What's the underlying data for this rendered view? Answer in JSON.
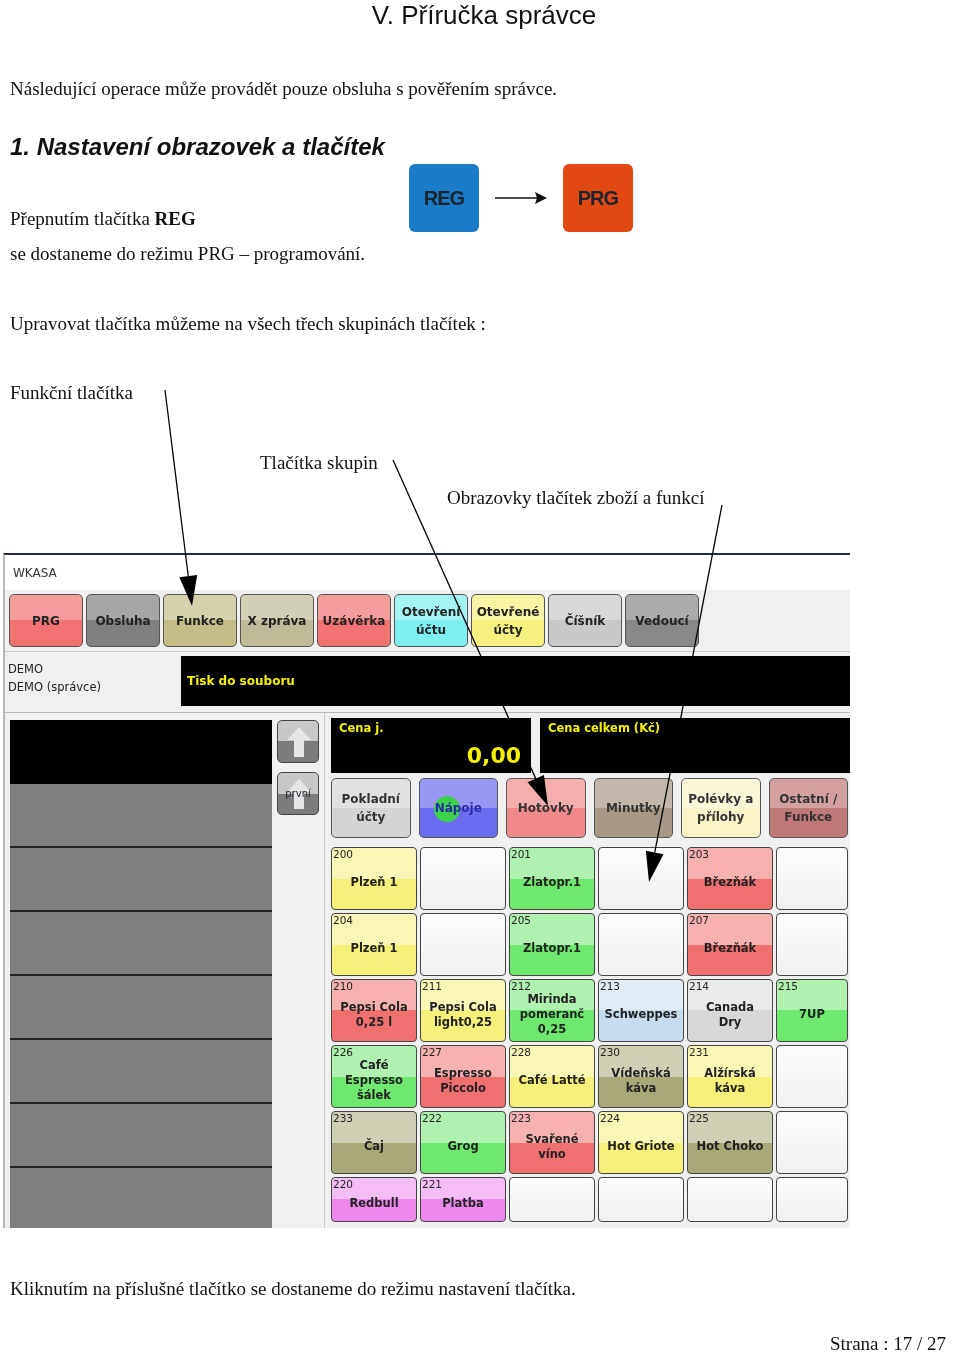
{
  "heading": "V. Příručka správce",
  "intro": "Následující operace může provádět pouze obsluha s pověřením správce.",
  "section": {
    "title": "1. Nastavení obrazovek a tlačítek",
    "lines": [
      "Přepnutím tlačítka **REG**",
      "se dostaneme do režimu PRG – programování."
    ],
    "modes": [
      {
        "label": "REG",
        "color": "#1a7cc6"
      },
      {
        "label": "PRG",
        "color": "#e04a12"
      }
    ]
  },
  "groups_intro": "Upravovat tlačítka můžeme na všech třech skupinách tlačítek :",
  "callouts": [
    "Funkční tlačítka",
    "Tlačítka skupin",
    "Obrazovky tlačítek zboží a funkcí"
  ],
  "app": {
    "title": "WKASA",
    "function_buttons": [
      {
        "label": "PRG",
        "color": "#f07272"
      },
      {
        "label": "Obsluha",
        "color": "#808080"
      },
      {
        "label": "Funkce",
        "color": "#c4be86"
      },
      {
        "label": "X zpráva",
        "color": "#bfbb98"
      },
      {
        "label": "Uzávěrka",
        "color": "#f07272"
      },
      {
        "label": "Otevření\núčtu",
        "color": "#7ef0f0"
      },
      {
        "label": "Otevřené\núčty",
        "color": "#f6f07e"
      },
      {
        "label": "Číšník",
        "color": "#c8c8c8"
      },
      {
        "label": "Vedoucí",
        "color": "#888888"
      }
    ],
    "user_lines": [
      "DEMO",
      "DEMO (správce)"
    ],
    "message": "Tisk do souboru",
    "nav": {
      "first_label": "první"
    },
    "unit_price": {
      "label": "Cena j.",
      "value": "0,00"
    },
    "total_price": {
      "label": "Cena celkem (Kč)"
    },
    "groups": [
      {
        "label": "Pokladní\núčty",
        "color": "#d4d4d4",
        "selected": false
      },
      {
        "label": "Nápoje",
        "color": "#6c6cf0",
        "selected": true
      },
      {
        "label": "Hotovky",
        "color": "#f08a8a",
        "selected": false
      },
      {
        "label": "Minutky",
        "color": "#a89886",
        "selected": false
      },
      {
        "label": "Polévky a\npřílohy",
        "color": "#f8f4c8",
        "selected": false
      },
      {
        "label": "Ostatní /\nFunkce",
        "color": "#c07878",
        "selected": false
      }
    ],
    "cells": [
      {
        "kind": "item",
        "number": "200",
        "label": "Plzeň 1",
        "color": "#f4f07a"
      },
      {
        "kind": "empty"
      },
      {
        "kind": "item",
        "number": "201",
        "label": "Zlatopr.1",
        "color": "#6ee86e"
      },
      {
        "kind": "empty"
      },
      {
        "kind": "item",
        "number": "203",
        "label": "Březňák",
        "color": "#f07070"
      },
      {
        "kind": "empty"
      },
      {
        "kind": "item",
        "number": "204",
        "label": "Plzeň 1",
        "color": "#f4f07a"
      },
      {
        "kind": "empty"
      },
      {
        "kind": "item",
        "number": "205",
        "label": "Zlatopr.1",
        "color": "#6ee86e"
      },
      {
        "kind": "empty"
      },
      {
        "kind": "item",
        "number": "207",
        "label": "Březňák",
        "color": "#f07070"
      },
      {
        "kind": "empty"
      },
      {
        "kind": "item",
        "number": "210",
        "label": "Pepsi Cola\n0,25 l",
        "color": "#f07070"
      },
      {
        "kind": "item",
        "number": "211",
        "label": "Pepsi Cola\nlight0,25",
        "color": "#f4f07a"
      },
      {
        "kind": "item",
        "number": "212",
        "label": "Mirinda\npomeranč\n0,25",
        "color": "#6ee86e"
      },
      {
        "kind": "item",
        "number": "213",
        "label": "Schweppes",
        "color": "#c8dcf0"
      },
      {
        "kind": "item",
        "number": "214",
        "label": "Canada\nDry",
        "color": "#d8d8d8"
      },
      {
        "kind": "item",
        "number": "215",
        "label": "7UP",
        "color": "#6ee86e"
      },
      {
        "kind": "item",
        "number": "226",
        "label": "Café\nEspresso\nšálek",
        "color": "#6ee86e"
      },
      {
        "kind": "item",
        "number": "227",
        "label": "Espresso\nPiccolo",
        "color": "#f07070"
      },
      {
        "kind": "item",
        "number": "228",
        "label": "Café Latté",
        "color": "#f4f07a"
      },
      {
        "kind": "item",
        "number": "230",
        "label": "Vídeňská\nkáva",
        "color": "#a8a878"
      },
      {
        "kind": "item",
        "number": "231",
        "label": "Alžírská\nkáva",
        "color": "#f4f07a"
      },
      {
        "kind": "empty"
      },
      {
        "kind": "item",
        "number": "233",
        "label": "Čaj",
        "color": "#a8a878"
      },
      {
        "kind": "item",
        "number": "222",
        "label": "Grog",
        "color": "#6ee86e"
      },
      {
        "kind": "item",
        "number": "223",
        "label": "Svařené\nvíno",
        "color": "#f07070"
      },
      {
        "kind": "item",
        "number": "224",
        "label": "Hot Griote",
        "color": "#f4f07a"
      },
      {
        "kind": "item",
        "number": "225",
        "label": "Hot Choko",
        "color": "#a8a878"
      },
      {
        "kind": "empty"
      },
      {
        "kind": "item",
        "number": "220",
        "label": "Redbull",
        "color": "#ee88ee"
      },
      {
        "kind": "item",
        "number": "221",
        "label": "Platba",
        "color": "#ee88ee"
      },
      {
        "kind": "empty"
      },
      {
        "kind": "empty"
      },
      {
        "kind": "empty"
      },
      {
        "kind": "empty"
      }
    ]
  },
  "footer": "Kliknutím na příslušné tlačítko se dostaneme do režimu nastavení tlačítka.",
  "page_number": "Strana : 17 / 27"
}
